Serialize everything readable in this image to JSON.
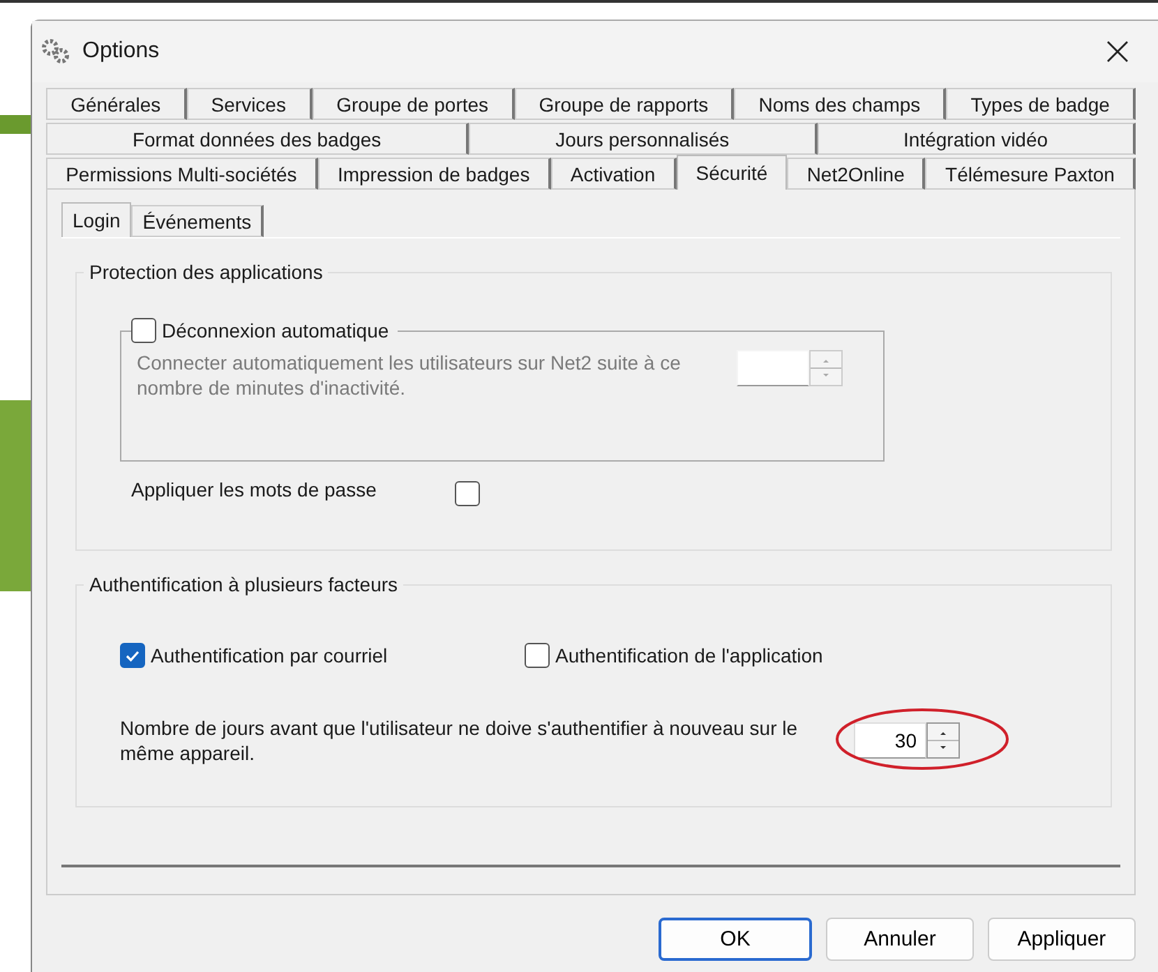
{
  "window": {
    "title": "Options"
  },
  "tab_rows": [
    [
      {
        "label": "Générales",
        "selected": false
      },
      {
        "label": "Services",
        "selected": false
      },
      {
        "label": "Groupe de portes",
        "selected": false
      },
      {
        "label": "Groupe de rapports",
        "selected": false
      },
      {
        "label": "Noms des champs",
        "selected": false
      },
      {
        "label": "Types de badge",
        "selected": false
      }
    ],
    [
      {
        "label": "Format données des badges",
        "selected": false
      },
      {
        "label": "Jours personnalisés",
        "selected": false
      },
      {
        "label": "Intégration vidéo",
        "selected": false
      }
    ],
    [
      {
        "label": "Permissions Multi-sociétés",
        "selected": false
      },
      {
        "label": "Impression de badges",
        "selected": false
      },
      {
        "label": "Activation",
        "selected": false
      },
      {
        "label": "Sécurité",
        "selected": true
      },
      {
        "label": "Net2Online",
        "selected": false
      },
      {
        "label": "Télémesure Paxton",
        "selected": false
      }
    ]
  ],
  "inner_tabs": [
    {
      "label": "Login",
      "selected": true
    },
    {
      "label": "Événements",
      "selected": false
    }
  ],
  "app_protection": {
    "title": "Protection des applications",
    "auto_logout": {
      "label": "Déconnexion automatique",
      "checked": false,
      "description": "Connecter automatiquement les utilisateurs sur Net2 suite à ce nombre de minutes d'inactivité.",
      "disabled": true
    },
    "secure_passwords": {
      "label": "Appliquer les mots de passe",
      "checked": false
    }
  },
  "mfa": {
    "title": "Authentification à plusieurs facteurs",
    "options": [
      {
        "label": "Authentification par courriel",
        "checked": true
      },
      {
        "label": "Authentification de l'application",
        "checked": false
      }
    ],
    "days": {
      "label": "Nombre de jours avant que l'utilisateur ne doive s'authentifier à nouveau sur le même appareil.",
      "value": "30"
    }
  },
  "buttons": [
    {
      "label": "OK",
      "default": true
    },
    {
      "label": "Annuler",
      "default": false
    },
    {
      "label": "Appliquer",
      "default": false
    }
  ]
}
